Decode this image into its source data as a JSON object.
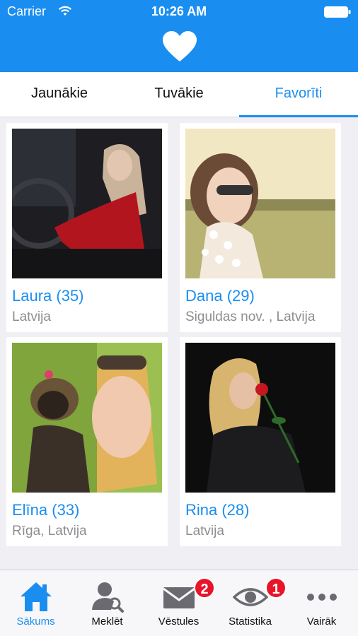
{
  "status_bar": {
    "carrier": "Carrier",
    "time": "10:26 AM"
  },
  "brand": {
    "color": "#1a8ef0",
    "logo_icon": "heart-icon"
  },
  "tabs": [
    {
      "label": "Jaunākie",
      "active": false
    },
    {
      "label": "Tuvākie",
      "active": false
    },
    {
      "label": "Favorīti",
      "active": true
    }
  ],
  "profiles": [
    {
      "name": "Laura (35)",
      "location": "Latvija"
    },
    {
      "name": "Dana (29)",
      "location": "Siguldas nov. , Latvija"
    },
    {
      "name": "Elīna (33)",
      "location": "Rīga, Latvija"
    },
    {
      "name": "Rina (28)",
      "location": "Latvija"
    }
  ],
  "bottom_nav": [
    {
      "label": "Sākums",
      "icon": "home-icon",
      "active": true
    },
    {
      "label": "Meklēt",
      "icon": "search-user-icon",
      "active": false
    },
    {
      "label": "Vēstules",
      "icon": "envelope-icon",
      "badge": "2",
      "active": false
    },
    {
      "label": "Statistika",
      "icon": "eye-icon",
      "badge": "1",
      "active": false
    },
    {
      "label": "Vairāk",
      "icon": "more-icon",
      "active": false
    }
  ]
}
